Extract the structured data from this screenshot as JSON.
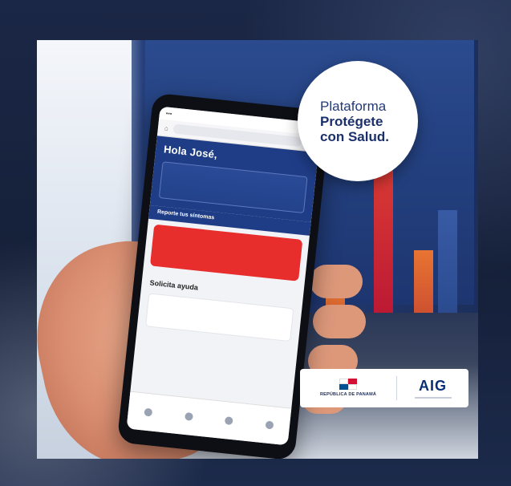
{
  "badge": {
    "line1": "Plataforma",
    "line2": "Protégete",
    "line3": "con Salud."
  },
  "phone": {
    "greeting": "Hola José,",
    "section_title": "Reporte tus síntomas",
    "mid_title": "Solicita ayuda"
  },
  "logos": {
    "left_name": "REPÚBLICA DE PANAMÁ",
    "right_name": "AIG"
  },
  "colors": {
    "brand_blue": "#1f3d87",
    "alert_red": "#e82d2d",
    "aig_blue": "#0a2e73"
  }
}
